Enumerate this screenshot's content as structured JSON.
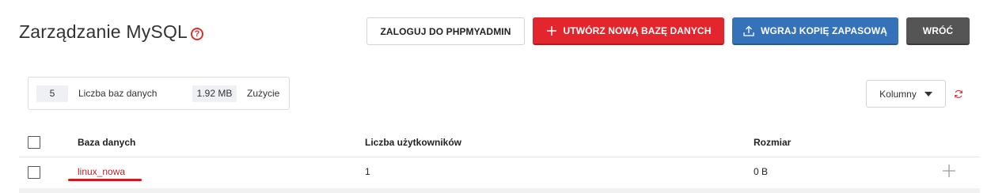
{
  "header": {
    "title": "Zarządzanie MySQL",
    "help_icon": "?"
  },
  "toolbar": {
    "login_label": "ZALOGUJ DO PHPMYADMIN",
    "create_label": "UTWÓRZ NOWĄ BAZĘ DANYCH",
    "upload_label": "WGRAJ KOPIĘ ZAPASOWĄ",
    "back_label": "WRÓĆ"
  },
  "stats": {
    "db_count": "5",
    "db_count_label": "Liczba baz danych",
    "usage_value": "1.92 MB",
    "usage_label": "Zużycie"
  },
  "controls": {
    "columns_label": "Kolumny"
  },
  "table": {
    "columns": [
      "Baza danych",
      "Liczba użytkowników",
      "Rozmiar"
    ],
    "rows": [
      {
        "name": "linux_nowa",
        "users": "1",
        "size": "0 B"
      }
    ]
  },
  "colors": {
    "danger": "#e3262d",
    "primary": "#3672b9",
    "dark": "#555555"
  },
  "icons": {
    "help": "help-circle-icon",
    "create": "plus-icon",
    "upload": "upload-icon",
    "columns": "caret-down-icon",
    "refresh": "refresh-icon",
    "row_action": "plus-icon"
  }
}
